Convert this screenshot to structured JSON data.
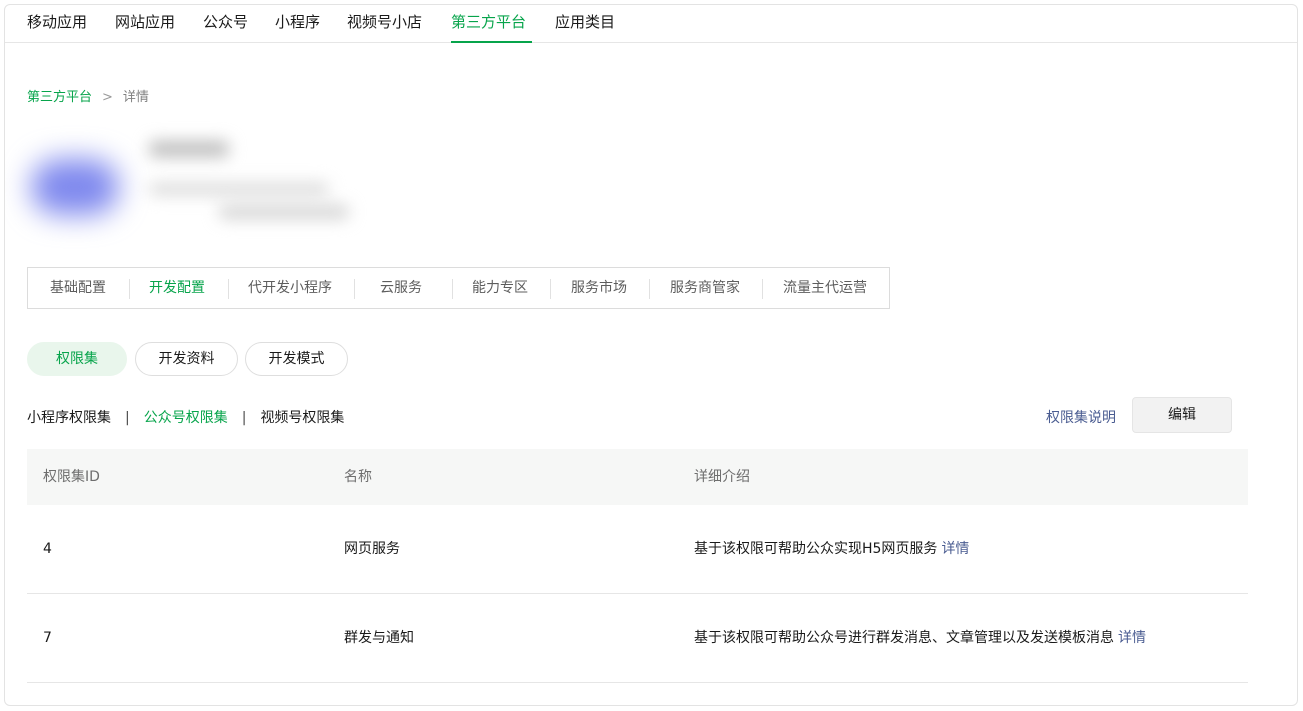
{
  "topnav": {
    "tabs": [
      {
        "label": "移动应用",
        "active": false
      },
      {
        "label": "网站应用",
        "active": false
      },
      {
        "label": "公众号",
        "active": false
      },
      {
        "label": "小程序",
        "active": false
      },
      {
        "label": "视频号小店",
        "active": false
      },
      {
        "label": "第三方平台",
        "active": true
      },
      {
        "label": "应用类目",
        "active": false
      }
    ]
  },
  "breadcrumb": {
    "parent": "第三方平台",
    "separator": ">",
    "current": "详情"
  },
  "section_tabs": [
    {
      "label": "基础配置",
      "active": false
    },
    {
      "label": "开发配置",
      "active": true
    },
    {
      "label": "代开发小程序",
      "active": false
    },
    {
      "label": "云服务",
      "active": false
    },
    {
      "label": "能力专区",
      "active": false
    },
    {
      "label": "服务市场",
      "active": false
    },
    {
      "label": "服务商管家",
      "active": false
    },
    {
      "label": "流量主代运营",
      "active": false
    }
  ],
  "pills": [
    {
      "label": "权限集",
      "active": true
    },
    {
      "label": "开发资料",
      "active": false
    },
    {
      "label": "开发模式",
      "active": false
    }
  ],
  "subtabs": {
    "items": [
      {
        "label": "小程序权限集",
        "active": false
      },
      {
        "label": "公众号权限集",
        "active": true
      },
      {
        "label": "视频号权限集",
        "active": false
      }
    ],
    "separator": "|"
  },
  "actions": {
    "help_link": "权限集说明",
    "edit_button": "编辑"
  },
  "table": {
    "headers": [
      "权限集ID",
      "名称",
      "详细介绍"
    ],
    "rows": [
      {
        "id": "4",
        "name": "网页服务",
        "desc": "基于该权限可帮助公众实现H5网页服务",
        "link": "详情"
      },
      {
        "id": "7",
        "name": "群发与通知",
        "desc": "基于该权限可帮助公众号进行群发消息、文章管理以及发送模板消息",
        "link": "详情"
      }
    ]
  },
  "colors": {
    "accent_green": "#07a44b",
    "link_blue": "#4a5c91",
    "avatar_blur": "#7f89ee"
  }
}
